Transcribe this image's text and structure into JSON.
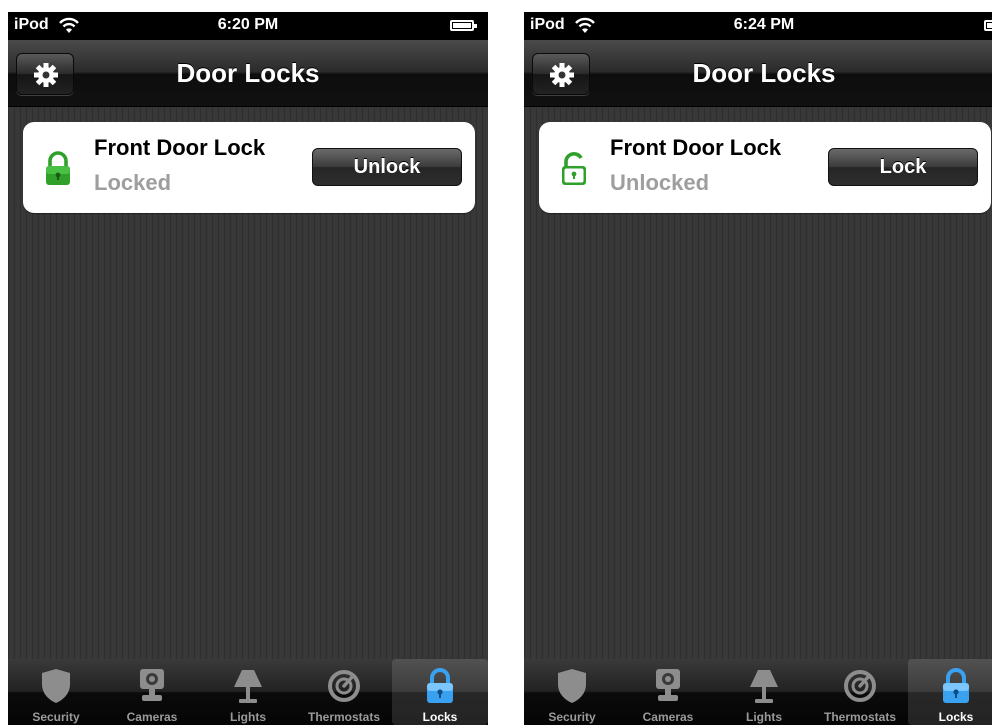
{
  "screens": [
    {
      "status_bar": {
        "device": "iPod",
        "time": "6:20 PM"
      },
      "nav": {
        "title": "Door Locks"
      },
      "lock": {
        "name": "Front Door Lock",
        "status": "Locked",
        "action_label": "Unlock",
        "icon": "lock-closed-icon"
      },
      "tabs": [
        {
          "label": "Security",
          "icon": "shield-icon"
        },
        {
          "label": "Cameras",
          "icon": "camera-icon"
        },
        {
          "label": "Lights",
          "icon": "lamp-icon"
        },
        {
          "label": "Thermostats",
          "icon": "thermostat-icon"
        },
        {
          "label": "Locks",
          "icon": "lock-icon",
          "active": true
        }
      ]
    },
    {
      "status_bar": {
        "device": "iPod",
        "time": "6:24 PM"
      },
      "nav": {
        "title": "Door Locks"
      },
      "lock": {
        "name": "Front Door Lock",
        "status": "Unlocked",
        "action_label": "Lock",
        "icon": "lock-open-icon"
      },
      "tabs": [
        {
          "label": "Security",
          "icon": "shield-icon"
        },
        {
          "label": "Cameras",
          "icon": "camera-icon"
        },
        {
          "label": "Lights",
          "icon": "lamp-icon"
        },
        {
          "label": "Thermostats",
          "icon": "thermostat-icon"
        },
        {
          "label": "Locks",
          "icon": "lock-icon",
          "active": true
        }
      ]
    }
  ],
  "colors": {
    "lock_green": "#2fa12b",
    "tab_active_blue": "#3aa0f0",
    "status_gray": "#9e9e9e"
  }
}
